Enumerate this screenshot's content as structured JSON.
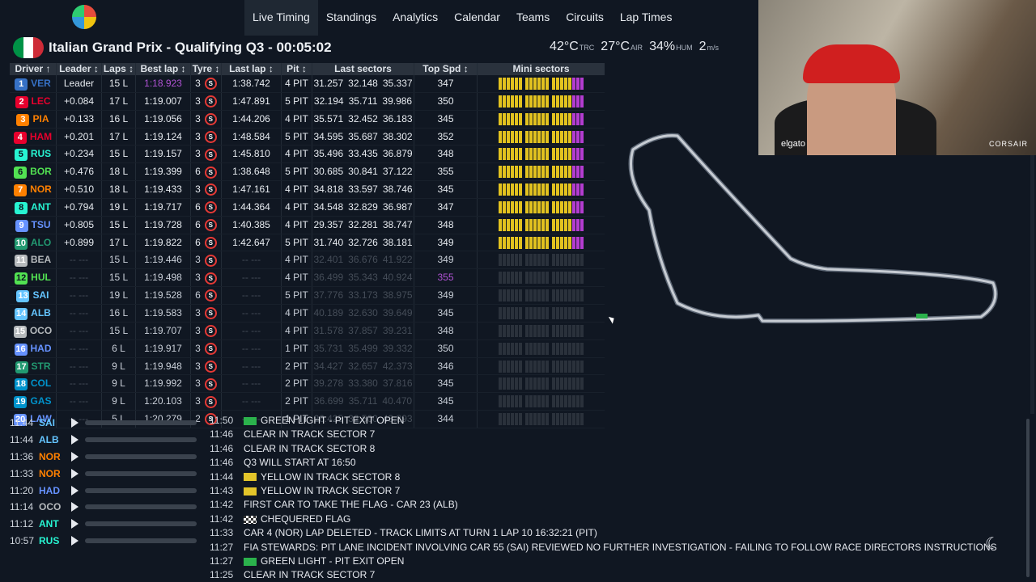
{
  "nav": {
    "items": [
      "Live Timing",
      "Standings",
      "Analytics",
      "Calendar",
      "Teams",
      "Circuits",
      "Lap Times"
    ],
    "active": "Live Timing"
  },
  "session": {
    "title": "Italian Grand Prix - Qualifying Q3 - 00:05:02",
    "flag_colors": [
      "#009246",
      "#ffffff",
      "#ce2b37"
    ],
    "weather": [
      {
        "value": "42°C",
        "unit": "TRC"
      },
      {
        "value": "27°C",
        "unit": "AIR"
      },
      {
        "value": "34%",
        "unit": "HUM"
      },
      {
        "value": "2",
        "unit": "m/s"
      }
    ]
  },
  "grid": {
    "headers": [
      "Driver ↑",
      "Leader ↕",
      "Laps ↕",
      "Best lap ↕",
      "Tyre ↕",
      "Last lap ↕",
      "Pit ↕",
      "Last sectors",
      "Top Spd ↕",
      "Mini sectors"
    ],
    "rows": [
      {
        "pos": "1",
        "tla": "VER",
        "color": "#3671c6",
        "leader": "Leader",
        "laps": "15 L",
        "best": "1:18.923",
        "best_purple": true,
        "tyre": "3",
        "last": "1:38.742",
        "pit": "4 PIT",
        "s1": "31.257",
        "s2": "32.148",
        "s3": "35.337",
        "spd": "347",
        "active": true
      },
      {
        "pos": "2",
        "tla": "LEC",
        "color": "#e8002d",
        "leader": "+0.084",
        "laps": "17 L",
        "best": "1:19.007",
        "tyre": "3",
        "last": "1:47.891",
        "pit": "5 PIT",
        "s1": "32.194",
        "s2": "35.711",
        "s3": "39.986",
        "spd": "350",
        "active": true
      },
      {
        "pos": "3",
        "tla": "PIA",
        "color": "#ff8000",
        "leader": "+0.133",
        "laps": "16 L",
        "best": "1:19.056",
        "tyre": "3",
        "last": "1:44.206",
        "pit": "4 PIT",
        "s1": "35.571",
        "s2": "32.452",
        "s3": "36.183",
        "spd": "345",
        "active": true
      },
      {
        "pos": "4",
        "tla": "HAM",
        "color": "#e8002d",
        "leader": "+0.201",
        "laps": "17 L",
        "best": "1:19.124",
        "tyre": "3",
        "last": "1:48.584",
        "pit": "5 PIT",
        "s1": "34.595",
        "s2": "35.687",
        "s3": "38.302",
        "spd": "352",
        "active": true
      },
      {
        "pos": "5",
        "tla": "RUS",
        "color": "#27f4d2",
        "leader": "+0.234",
        "laps": "15 L",
        "best": "1:19.157",
        "tyre": "3",
        "last": "1:45.810",
        "pit": "4 PIT",
        "s1": "35.496",
        "s2": "33.435",
        "s3": "36.879",
        "spd": "348",
        "active": true
      },
      {
        "pos": "6",
        "tla": "BOR",
        "color": "#52e252",
        "leader": "+0.476",
        "laps": "18 L",
        "best": "1:19.399",
        "tyre": "6",
        "last": "1:38.648",
        "pit": "5 PIT",
        "s1": "30.685",
        "s2": "30.841",
        "s3": "37.122",
        "spd": "355",
        "active": true
      },
      {
        "pos": "7",
        "tla": "NOR",
        "color": "#ff8000",
        "leader": "+0.510",
        "laps": "18 L",
        "best": "1:19.433",
        "tyre": "3",
        "last": "1:47.161",
        "pit": "4 PIT",
        "s1": "34.818",
        "s2": "33.597",
        "s3": "38.746",
        "spd": "345",
        "active": true
      },
      {
        "pos": "8",
        "tla": "ANT",
        "color": "#27f4d2",
        "leader": "+0.794",
        "laps": "19 L",
        "best": "1:19.717",
        "tyre": "6",
        "last": "1:44.364",
        "pit": "4 PIT",
        "s1": "34.548",
        "s2": "32.829",
        "s3": "36.987",
        "spd": "347",
        "active": true
      },
      {
        "pos": "9",
        "tla": "TSU",
        "color": "#6692ff",
        "leader": "+0.805",
        "laps": "15 L",
        "best": "1:19.728",
        "tyre": "6",
        "last": "1:40.385",
        "pit": "4 PIT",
        "s1": "29.357",
        "s2": "32.281",
        "s3": "38.747",
        "spd": "348",
        "active": true
      },
      {
        "pos": "10",
        "tla": "ALO",
        "color": "#229971",
        "leader": "+0.899",
        "laps": "17 L",
        "best": "1:19.822",
        "tyre": "6",
        "last": "1:42.647",
        "pit": "5 PIT",
        "s1": "31.740",
        "s2": "32.726",
        "s3": "38.181",
        "spd": "349",
        "active": true
      },
      {
        "pos": "11",
        "tla": "BEA",
        "color": "#b6babd",
        "leader": "-- ---",
        "laps": "15 L",
        "best": "1:19.446",
        "tyre": "3",
        "last": "-- ---",
        "pit": "4 PIT",
        "s1": "32.401",
        "s2": "36.676",
        "s3": "41.922",
        "spd": "349",
        "active": false
      },
      {
        "pos": "12",
        "tla": "HUL",
        "color": "#52e252",
        "leader": "-- ---",
        "laps": "15 L",
        "best": "1:19.498",
        "tyre": "3",
        "last": "-- ---",
        "pit": "4 PIT",
        "s1": "36.499",
        "s2": "35.343",
        "s3": "40.924",
        "spd": "355",
        "spd_purple": true,
        "active": false
      },
      {
        "pos": "13",
        "tla": "SAI",
        "color": "#64c4ff",
        "leader": "-- ---",
        "laps": "19 L",
        "best": "1:19.528",
        "tyre": "6",
        "last": "-- ---",
        "pit": "5 PIT",
        "s1": "37.776",
        "s2": "33.173",
        "s3": "38.975",
        "spd": "349",
        "active": false
      },
      {
        "pos": "14",
        "tla": "ALB",
        "color": "#64c4ff",
        "leader": "-- ---",
        "laps": "16 L",
        "best": "1:19.583",
        "tyre": "3",
        "last": "-- ---",
        "pit": "4 PIT",
        "s1": "40.189",
        "s2": "32.630",
        "s3": "39.649",
        "spd": "345",
        "active": false
      },
      {
        "pos": "15",
        "tla": "OCO",
        "color": "#b6babd",
        "leader": "-- ---",
        "laps": "15 L",
        "best": "1:19.707",
        "tyre": "3",
        "last": "-- ---",
        "pit": "4 PIT",
        "s1": "31.578",
        "s2": "37.857",
        "s3": "39.231",
        "spd": "348",
        "active": false
      },
      {
        "pos": "16",
        "tla": "HAD",
        "color": "#6692ff",
        "leader": "-- ---",
        "laps": "6 L",
        "best": "1:19.917",
        "tyre": "3",
        "last": "-- ---",
        "pit": "1 PIT",
        "s1": "35.731",
        "s2": "35.499",
        "s3": "39.332",
        "spd": "350",
        "active": false
      },
      {
        "pos": "17",
        "tla": "STR",
        "color": "#229971",
        "leader": "-- ---",
        "laps": "9 L",
        "best": "1:19.948",
        "tyre": "3",
        "last": "-- ---",
        "pit": "2 PIT",
        "s1": "34.427",
        "s2": "32.657",
        "s3": "42.373",
        "spd": "346",
        "active": false
      },
      {
        "pos": "18",
        "tla": "COL",
        "color": "#0093cc",
        "leader": "-- ---",
        "laps": "9 L",
        "best": "1:19.992",
        "tyre": "3",
        "last": "-- ---",
        "pit": "2 PIT",
        "s1": "39.278",
        "s2": "33.380",
        "s3": "37.816",
        "spd": "345",
        "active": false
      },
      {
        "pos": "19",
        "tla": "GAS",
        "color": "#0093cc",
        "leader": "-- ---",
        "laps": "9 L",
        "best": "1:20.103",
        "tyre": "3",
        "last": "-- ---",
        "pit": "2 PIT",
        "s1": "36.699",
        "s2": "35.711",
        "s3": "40.470",
        "spd": "345",
        "active": false
      },
      {
        "pos": "20",
        "tla": "LAW",
        "color": "#6692ff",
        "leader": "-- ---",
        "laps": "5 L",
        "best": "1:20.279",
        "tyre": "2",
        "last": "-- ---",
        "pit": "1 PIT",
        "s1": "26.425",
        "s2": "32.500",
        "s3": "43.893",
        "spd": "344",
        "active": false
      }
    ],
    "tyre_compound": "S"
  },
  "team_radio": [
    {
      "time": "11:44",
      "tla": "SAI",
      "color": "#64c4ff"
    },
    {
      "time": "11:44",
      "tla": "ALB",
      "color": "#64c4ff"
    },
    {
      "time": "11:36",
      "tla": "NOR",
      "color": "#ff8000"
    },
    {
      "time": "11:33",
      "tla": "NOR",
      "color": "#ff8000"
    },
    {
      "time": "11:20",
      "tla": "HAD",
      "color": "#6692ff"
    },
    {
      "time": "11:14",
      "tla": "OCO",
      "color": "#b6babd"
    },
    {
      "time": "11:12",
      "tla": "ANT",
      "color": "#27f4d2"
    },
    {
      "time": "10:57",
      "tla": "RUS",
      "color": "#27f4d2"
    }
  ],
  "race_control": [
    {
      "time": "11:50",
      "icon": "green",
      "text": "GREEN LIGHT - PIT EXIT OPEN"
    },
    {
      "time": "11:46",
      "icon": "",
      "text": "CLEAR IN TRACK SECTOR 7"
    },
    {
      "time": "11:46",
      "icon": "",
      "text": "CLEAR IN TRACK SECTOR 8"
    },
    {
      "time": "11:46",
      "icon": "",
      "text": "Q3 WILL START AT 16:50"
    },
    {
      "time": "11:44",
      "icon": "yellow",
      "text": "YELLOW IN TRACK SECTOR 8"
    },
    {
      "time": "11:43",
      "icon": "yellow",
      "text": "YELLOW IN TRACK SECTOR 7"
    },
    {
      "time": "11:42",
      "icon": "",
      "text": "FIRST CAR TO TAKE THE FLAG - CAR 23 (ALB)"
    },
    {
      "time": "11:42",
      "icon": "cheq",
      "text": "CHEQUERED FLAG"
    },
    {
      "time": "11:33",
      "icon": "",
      "text": "CAR 4 (NOR) LAP DELETED - TRACK LIMITS AT TURN 1 LAP 10 16:32:21 (PIT)"
    },
    {
      "time": "11:27",
      "icon": "",
      "text": "FIA STEWARDS: PIT LANE INCIDENT INVOLVING CAR 55 (SAI) REVIEWED NO FURTHER INVESTIGATION - FAILING TO FOLLOW RACE DIRECTORS INSTRUCTIONS"
    },
    {
      "time": "11:27",
      "icon": "green",
      "text": "GREEN LIGHT - PIT EXIT OPEN"
    },
    {
      "time": "11:25",
      "icon": "",
      "text": "CLEAR IN TRACK SECTOR 7"
    }
  ],
  "webcam": {
    "brand_left": "elgato",
    "brand_right": "CORSAIR"
  },
  "theme_icon": "moon-icon"
}
